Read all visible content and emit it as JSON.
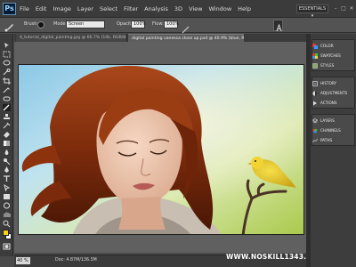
{
  "app": {
    "logo": "Ps"
  },
  "menu": {
    "items": [
      "File",
      "Edit",
      "Image",
      "Layer",
      "Select",
      "Filter",
      "Analysis",
      "3D",
      "View",
      "Window",
      "Help"
    ]
  },
  "workspace": "ESSENTIALS ▾",
  "window_controls": {
    "minimize": "–",
    "restore": "□",
    "close": "✕"
  },
  "options_bar": {
    "brush_label": "Brush:",
    "mode_label": "Mode:",
    "mode_value": "Screen",
    "opacity_label": "Opacity:",
    "opacity_value": "100%",
    "flow_label": "Flow:",
    "flow_value": "100%"
  },
  "tabs": [
    {
      "label": "4_tutorial_digital_painting.jpg @ 66.7% (10k, RGB/8#) ×",
      "active": false
    },
    {
      "label": "digital painting vanessa close up.psd @ 40.9% (blue, RGB/8) ×",
      "active": true
    }
  ],
  "status": {
    "zoom": "40 %",
    "doc": "Doc: 4.87M/136.3M"
  },
  "watermark": "WWW.NOSKILL1343.COM",
  "panels": {
    "group1": [
      "COLOR",
      "SWATCHES",
      "STYLES"
    ],
    "group2": [
      "HISTORY",
      "ADJUSTMENTS",
      "ACTIONS"
    ],
    "group3": [
      "LAYERS",
      "CHANNELS",
      "PATHS"
    ]
  },
  "colors": {
    "foreground": "#f7d21a",
    "background": "#ffffff",
    "ui_dark": "#3b3b3b"
  }
}
